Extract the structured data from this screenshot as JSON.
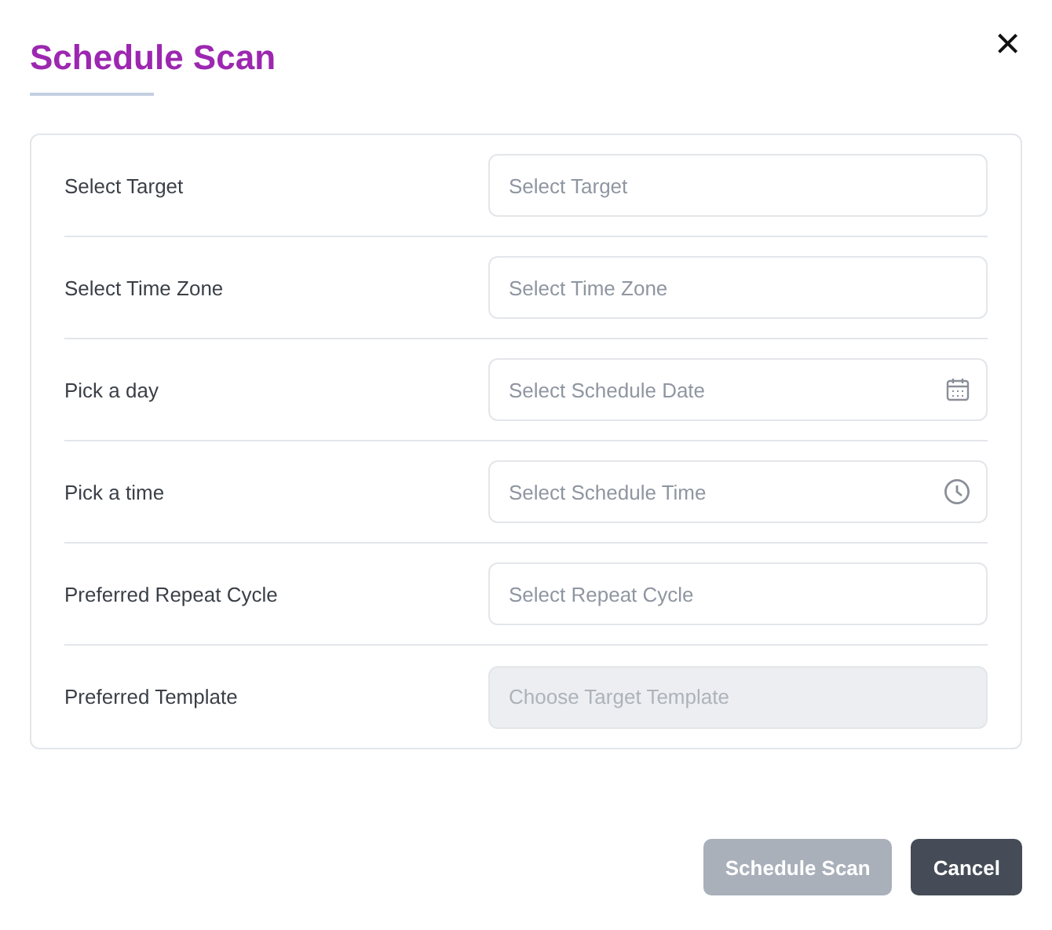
{
  "dialog": {
    "title": "Schedule Scan",
    "close": "×"
  },
  "fields": [
    {
      "label": "Select Target",
      "placeholder": "Select Target",
      "kind": "text",
      "disabled": false
    },
    {
      "label": "Select Time Zone",
      "placeholder": "Select Time Zone",
      "kind": "text",
      "disabled": false
    },
    {
      "label": "Pick a day",
      "placeholder": "Select Schedule Date",
      "kind": "date",
      "disabled": false
    },
    {
      "label": "Pick a time",
      "placeholder": "Select Schedule Time",
      "kind": "time",
      "disabled": false
    },
    {
      "label": "Preferred Repeat Cycle",
      "placeholder": "Select Repeat Cycle",
      "kind": "text",
      "disabled": false
    },
    {
      "label": "Preferred Template",
      "placeholder": "Choose Target Template",
      "kind": "text",
      "disabled": true
    }
  ],
  "buttons": [
    {
      "label": "Schedule Scan",
      "kind": "primary",
      "disabled": true
    },
    {
      "label": "Cancel",
      "kind": "secondary",
      "disabled": false
    }
  ]
}
